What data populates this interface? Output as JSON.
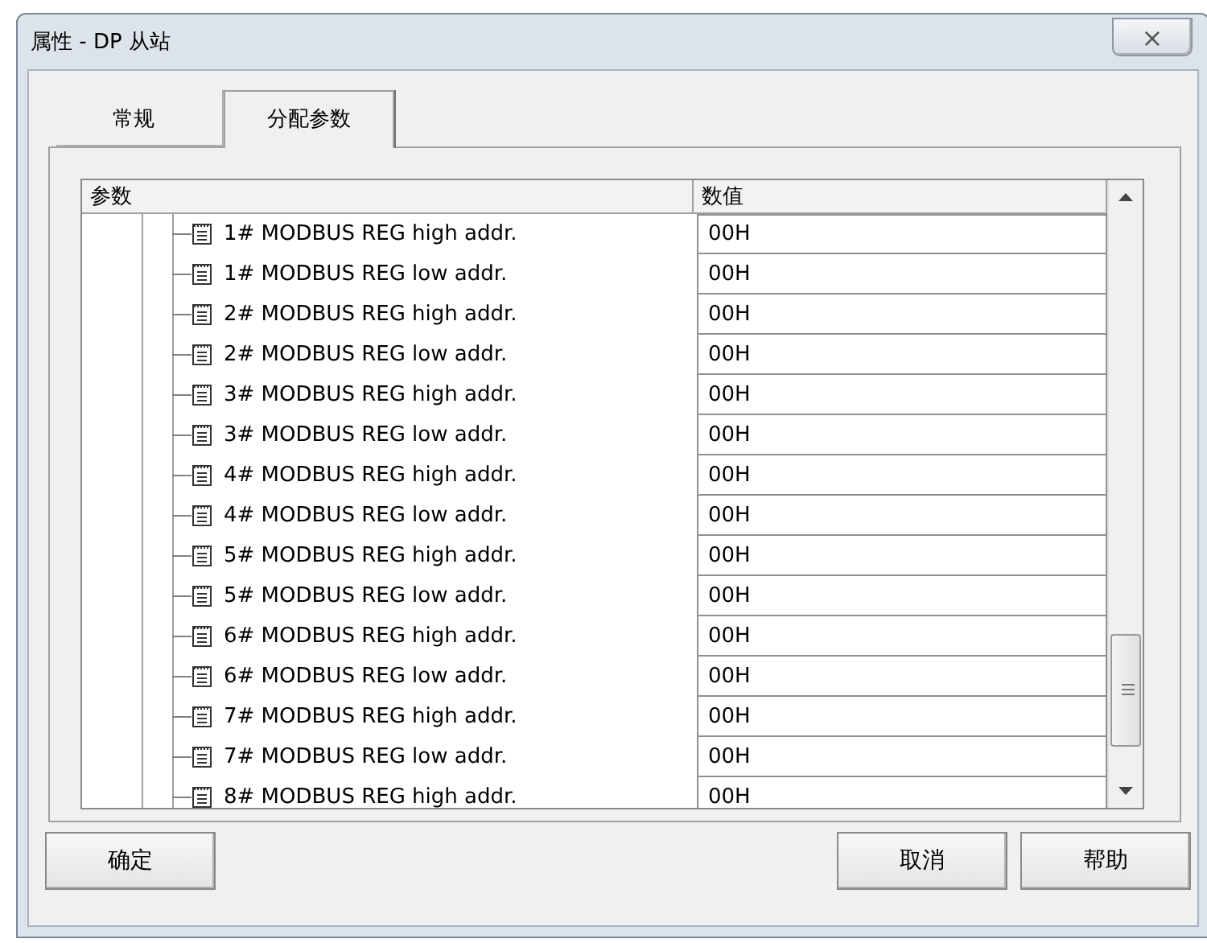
{
  "window": {
    "title": "属性 - DP 从站",
    "close": "×"
  },
  "tabs": [
    {
      "label": "常规",
      "selected": false
    },
    {
      "label": "分配参数",
      "selected": true
    }
  ],
  "table": {
    "columns": [
      "参数",
      "数值"
    ],
    "rows": [
      {
        "name": "1# MODBUS REG high addr.",
        "value": "00H"
      },
      {
        "name": "1# MODBUS REG low addr.",
        "value": "00H"
      },
      {
        "name": "2# MODBUS REG high addr.",
        "value": "00H"
      },
      {
        "name": "2# MODBUS REG low addr.",
        "value": "00H"
      },
      {
        "name": "3# MODBUS REG high addr.",
        "value": "00H"
      },
      {
        "name": "3# MODBUS REG low addr.",
        "value": "00H"
      },
      {
        "name": "4# MODBUS REG high addr.",
        "value": "00H"
      },
      {
        "name": "4# MODBUS REG low addr.",
        "value": "00H"
      },
      {
        "name": "5# MODBUS REG high addr.",
        "value": "00H"
      },
      {
        "name": "5# MODBUS REG low addr.",
        "value": "00H"
      },
      {
        "name": "6# MODBUS REG high addr.",
        "value": "00H"
      },
      {
        "name": "6# MODBUS REG low addr.",
        "value": "00H"
      },
      {
        "name": "7# MODBUS REG high addr.",
        "value": "00H"
      },
      {
        "name": "7# MODBUS REG low addr.",
        "value": "00H"
      },
      {
        "name": "8# MODBUS REG high addr.",
        "value": "00H"
      }
    ]
  },
  "buttons": [
    {
      "label": "确定",
      "kind": "confirm"
    },
    {
      "label": "取消",
      "kind": "action"
    },
    {
      "label": "帮助",
      "kind": "action"
    }
  ]
}
